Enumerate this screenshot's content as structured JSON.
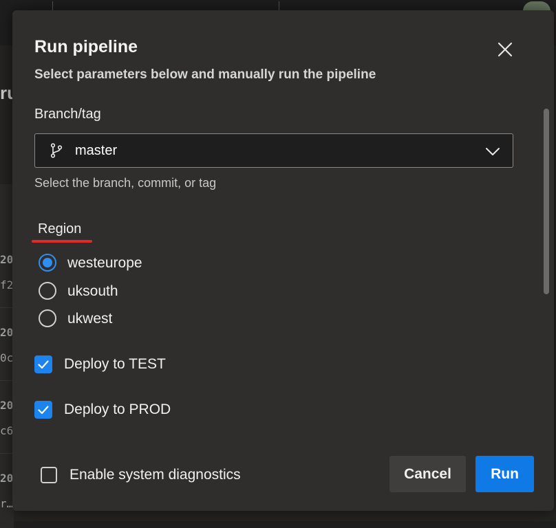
{
  "background": {
    "rows": [
      "20",
      "f2",
      "20",
      "0c",
      "20",
      "c6",
      "20",
      "r…"
    ],
    "partial_title": "ru"
  },
  "dialog": {
    "title": "Run pipeline",
    "subtitle": "Select parameters below and manually run the pipeline",
    "close_icon": "close-icon",
    "branch": {
      "label": "Branch/tag",
      "value": "master",
      "icon": "git-branch-icon",
      "hint": "Select the branch, commit, or tag"
    },
    "region": {
      "label": "Region",
      "options": [
        {
          "label": "westeurope",
          "selected": true
        },
        {
          "label": "uksouth",
          "selected": false
        },
        {
          "label": "ukwest",
          "selected": false
        }
      ]
    },
    "checkboxes": [
      {
        "label": "Deploy to TEST",
        "checked": true
      },
      {
        "label": "Deploy to PROD",
        "checked": true
      }
    ],
    "diagnostics": {
      "label": "Enable system diagnostics",
      "checked": false
    },
    "buttons": {
      "cancel": "Cancel",
      "run": "Run"
    }
  },
  "colors": {
    "accent": "#0f7ae5",
    "annotation_underline": "#e02a2a",
    "dialog_bg": "#2f2e2d"
  }
}
